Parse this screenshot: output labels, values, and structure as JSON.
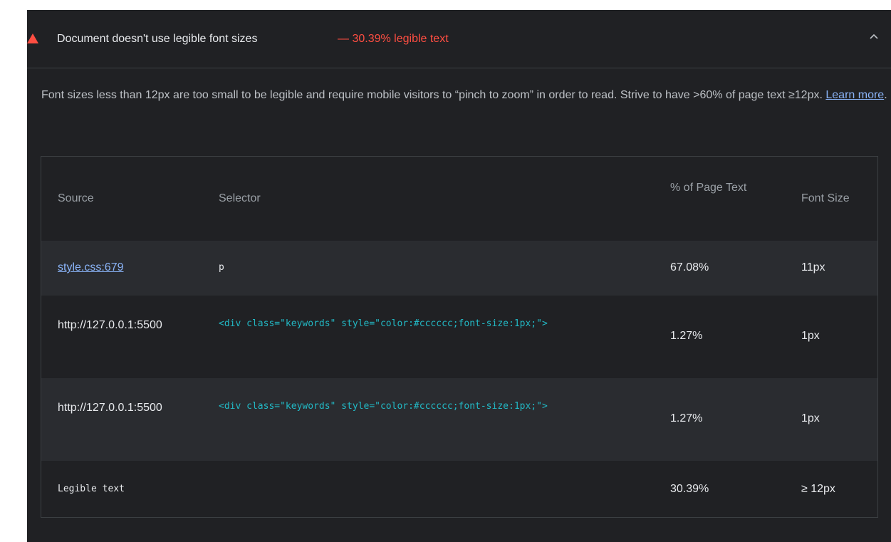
{
  "audit": {
    "title": "Document doesn't use legible font sizes",
    "display_value": "— 30.39% legible text",
    "status_color": "#ff4e42",
    "icon": "warning-triangle-icon",
    "expand_icon": "chevron-up-icon",
    "description_text": "Font sizes less than 12px are too small to be legible and require mobile visitors to “pinch to zoom” in order to read. Strive to have >60% of page text ≥12px.",
    "learn_more_label": "Learn more",
    "description_tail": "."
  },
  "table": {
    "headers": {
      "source": "Source",
      "selector": "Selector",
      "percent": "% of Page Text",
      "font_size": "Font Size"
    },
    "rows": [
      {
        "source": "style.css:679",
        "selector": "p",
        "percent": "67.08%",
        "font_size": "11px"
      },
      {
        "source": "http://127.0.0.1:5500",
        "selector": "<div class=\"keywords\" style=\"color:#cccccc;font-size:1px;\">",
        "percent": "1.27%",
        "font_size": "1px"
      },
      {
        "source": "http://127.0.0.1:5500",
        "selector": "<div class=\"keywords\" style=\"color:#cccccc;font-size:1px;\">",
        "percent": "1.27%",
        "font_size": "1px"
      },
      {
        "source": "Legible text",
        "selector": "",
        "percent": "30.39%",
        "font_size": "≥ 12px"
      }
    ]
  }
}
